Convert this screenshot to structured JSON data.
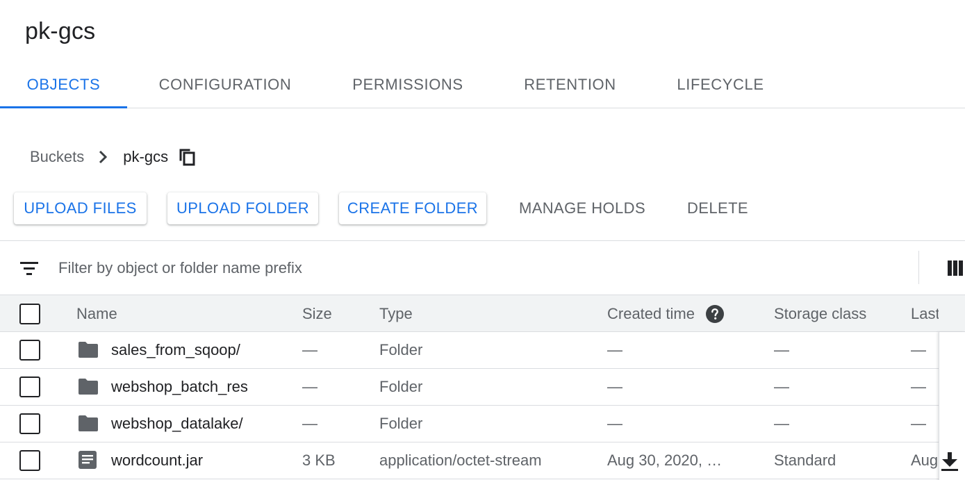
{
  "bucket": {
    "title": "pk-gcs"
  },
  "tabs": [
    {
      "label": "OBJECTS",
      "active": true
    },
    {
      "label": "CONFIGURATION",
      "active": false
    },
    {
      "label": "PERMISSIONS",
      "active": false
    },
    {
      "label": "RETENTION",
      "active": false
    },
    {
      "label": "LIFECYCLE",
      "active": false
    }
  ],
  "breadcrumb": {
    "root": "Buckets",
    "current": "pk-gcs",
    "separator_icon": "chevron-right-icon",
    "copy_icon": "copy-icon"
  },
  "actions": {
    "upload_files": "UPLOAD FILES",
    "upload_folder": "UPLOAD FOLDER",
    "create_folder": "CREATE FOLDER",
    "manage_holds": "MANAGE HOLDS",
    "delete": "DELETE"
  },
  "filter": {
    "placeholder": "Filter by object or folder name prefix",
    "value": "",
    "icon": "filter-list-icon",
    "columns_icon": "column-display-icon"
  },
  "table": {
    "headers": {
      "name": "Name",
      "size": "Size",
      "type": "Type",
      "created": "Created time",
      "storage": "Storage class",
      "last": "Last"
    },
    "help_icon": "help-icon",
    "rows": [
      {
        "icon": "folder-icon",
        "name": "sales_from_sqoop/",
        "size": "—",
        "type": "Folder",
        "created": "—",
        "storage": "—",
        "last": "—"
      },
      {
        "icon": "folder-icon",
        "name": "webshop_batch_res",
        "size": "—",
        "type": "Folder",
        "created": "—",
        "storage": "—",
        "last": "—"
      },
      {
        "icon": "folder-icon",
        "name": "webshop_datalake/",
        "size": "—",
        "type": "Folder",
        "created": "—",
        "storage": "—",
        "last": "—"
      },
      {
        "icon": "file-icon",
        "name": "wordcount.jar",
        "size": "3 KB",
        "type": "application/octet-stream",
        "created": "Aug 30, 2020, …",
        "storage": "Standard",
        "last": "Aug",
        "action_icon": "download-icon"
      }
    ]
  },
  "colors": {
    "accent": "#1a73e8",
    "text_primary": "#202124",
    "text_secondary": "#5f6368",
    "divider": "#dadce0",
    "header_bg": "#f1f3f4"
  }
}
